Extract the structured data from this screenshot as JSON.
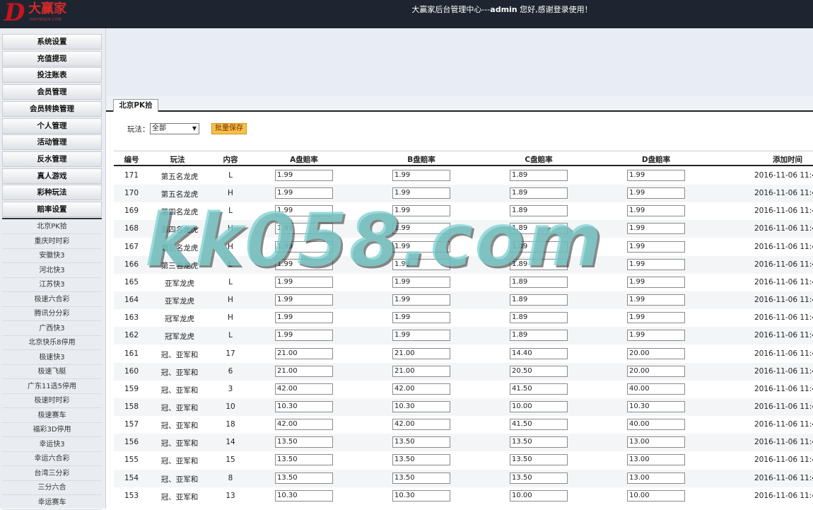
{
  "header": {
    "logo_text": "大赢家",
    "logo_letter": "D",
    "logo_sub": "DAYINGJIA.COM",
    "welcome_prefix": "大赢家后台管理中心---",
    "welcome_user": "admin",
    "welcome_suffix": " 您好,感谢登录使用！",
    "bg_color": "#1e2530"
  },
  "sidebar": {
    "menu": [
      "系统设置",
      "充值提现",
      "投注账表",
      "会员管理",
      "会员转换管理",
      "个人管理",
      "活动管理",
      "反水管理",
      "真人游戏",
      "彩种玩法",
      "赔率设置"
    ],
    "sub_items": [
      "北京PK拾",
      "重庆时时彩",
      "安徽快3",
      "河北快3",
      "江苏快3",
      "极速六合彩",
      "腾讯分分彩",
      "广西快3",
      "北京快乐8停用",
      "极速快3",
      "极速飞艇",
      "广东11选5停用",
      "极速时时彩",
      "极速赛车",
      "福彩3D停用",
      "幸运快3",
      "幸运六合彩",
      "台湾三分彩",
      "三分六合",
      "幸运赛车"
    ]
  },
  "tab": {
    "label": "北京PK拾"
  },
  "filter": {
    "play_label": "玩法：",
    "play_value": "全部",
    "save_label": "批量保存"
  },
  "table": {
    "headers": [
      "编号",
      "玩法",
      "内容",
      "A盘赔率",
      "B盘赔率",
      "C盘赔率",
      "D盘赔率",
      "添加时间"
    ],
    "rows": [
      {
        "id": "171",
        "play": "第五名龙虎",
        "content": "L",
        "a": "1.99",
        "b": "1.99",
        "c": "1.89",
        "d": "1.99",
        "time": "2016-11-06 11:4"
      },
      {
        "id": "170",
        "play": "第五名龙虎",
        "content": "H",
        "a": "1.99",
        "b": "1.99",
        "c": "1.89",
        "d": "1.99",
        "time": "2016-11-06 11:4"
      },
      {
        "id": "169",
        "play": "第四名龙虎",
        "content": "L",
        "a": "1.99",
        "b": "1.99",
        "c": "1.89",
        "d": "1.99",
        "time": "2016-11-06 11:4"
      },
      {
        "id": "168",
        "play": "第四名龙虎",
        "content": "H",
        "a": "1.99",
        "b": "1.99",
        "c": "1.89",
        "d": "1.99",
        "time": "2016-11-06 11:4"
      },
      {
        "id": "167",
        "play": "第三名龙虎",
        "content": "H",
        "a": "1.99",
        "b": "1.99",
        "c": "1.89",
        "d": "1.99",
        "time": "2016-11-06 11:4"
      },
      {
        "id": "166",
        "play": "第三名龙虎",
        "content": "L",
        "a": "1.99",
        "b": "1.99",
        "c": "1.89",
        "d": "1.99",
        "time": "2016-11-06 11:4"
      },
      {
        "id": "165",
        "play": "亚军龙虎",
        "content": "L",
        "a": "1.99",
        "b": "1.99",
        "c": "1.89",
        "d": "1.99",
        "time": "2016-11-06 11:4"
      },
      {
        "id": "164",
        "play": "亚军龙虎",
        "content": "H",
        "a": "1.99",
        "b": "1.99",
        "c": "1.89",
        "d": "1.99",
        "time": "2016-11-06 11:4"
      },
      {
        "id": "163",
        "play": "冠军龙虎",
        "content": "H",
        "a": "1.99",
        "b": "1.99",
        "c": "1.89",
        "d": "1.99",
        "time": "2016-11-06 11:4"
      },
      {
        "id": "162",
        "play": "冠军龙虎",
        "content": "L",
        "a": "1.99",
        "b": "1.99",
        "c": "1.89",
        "d": "1.99",
        "time": "2016-11-06 11:4"
      },
      {
        "id": "161",
        "play": "冠、亚军和",
        "content": "17",
        "a": "21.00",
        "b": "21.00",
        "c": "14.40",
        "d": "20.00",
        "time": "2016-11-06 11:4"
      },
      {
        "id": "160",
        "play": "冠、亚军和",
        "content": "6",
        "a": "21.00",
        "b": "21.00",
        "c": "20.50",
        "d": "20.00",
        "time": "2016-11-06 11:4"
      },
      {
        "id": "159",
        "play": "冠、亚军和",
        "content": "3",
        "a": "42.00",
        "b": "42.00",
        "c": "41.50",
        "d": "40.00",
        "time": "2016-11-06 11:4"
      },
      {
        "id": "158",
        "play": "冠、亚军和",
        "content": "10",
        "a": "10.30",
        "b": "10.30",
        "c": "10.00",
        "d": "10.30",
        "time": "2016-11-06 11:4"
      },
      {
        "id": "157",
        "play": "冠、亚军和",
        "content": "18",
        "a": "42.00",
        "b": "42.00",
        "c": "41.50",
        "d": "40.00",
        "time": "2016-11-06 11:4"
      },
      {
        "id": "156",
        "play": "冠、亚军和",
        "content": "14",
        "a": "13.50",
        "b": "13.50",
        "c": "13.50",
        "d": "13.00",
        "time": "2016-11-06 11:4"
      },
      {
        "id": "155",
        "play": "冠、亚军和",
        "content": "15",
        "a": "13.50",
        "b": "13.50",
        "c": "13.50",
        "d": "13.00",
        "time": "2016-11-06 11:4"
      },
      {
        "id": "154",
        "play": "冠、亚军和",
        "content": "8",
        "a": "13.50",
        "b": "13.50",
        "c": "13.50",
        "d": "13.00",
        "time": "2016-11-06 11:4"
      },
      {
        "id": "153",
        "play": "冠、亚军和",
        "content": "13",
        "a": "10.30",
        "b": "10.30",
        "c": "10.00",
        "d": "10.00",
        "time": "2016-11-06 11:4"
      }
    ]
  },
  "watermark": "kk058.com"
}
